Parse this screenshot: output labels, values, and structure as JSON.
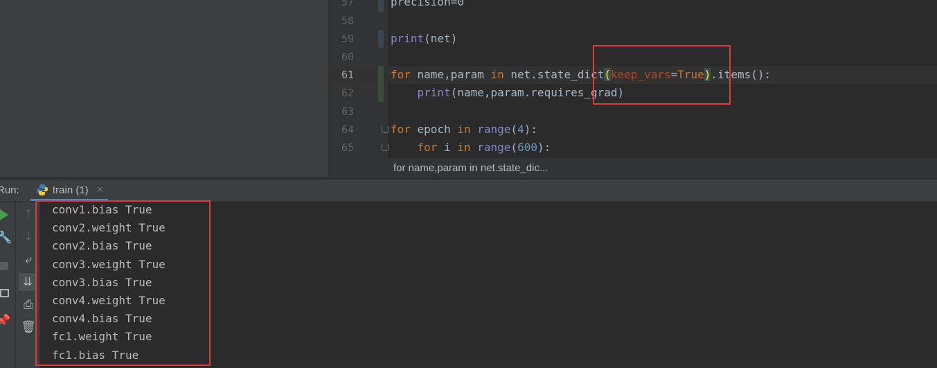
{
  "editor": {
    "lines": [
      {
        "num": "57",
        "tokens": [
          {
            "t": "precision=0",
            "c": ""
          }
        ]
      },
      {
        "num": "58",
        "tokens": []
      },
      {
        "num": "59",
        "tokens": [
          {
            "t": "print",
            "c": "bi"
          },
          {
            "t": "(net)",
            "c": ""
          }
        ]
      },
      {
        "num": "60",
        "tokens": []
      },
      {
        "num": "61",
        "current": true,
        "tokens": [
          {
            "t": "for",
            "c": "kw"
          },
          {
            "t": " name,param ",
            "c": ""
          },
          {
            "t": "in",
            "c": "kw"
          },
          {
            "t": " net.state_dict",
            "c": ""
          },
          {
            "t": "(",
            "c": "bracket-hl"
          },
          {
            "t": "keep_vars",
            "c": "param"
          },
          {
            "t": "=",
            "c": ""
          },
          {
            "t": "True",
            "c": "kw"
          },
          {
            "t": ")",
            "c": "bracket-hl"
          },
          {
            "t": ".items():",
            "c": ""
          }
        ]
      },
      {
        "num": "62",
        "tokens": [
          {
            "t": "    ",
            "c": ""
          },
          {
            "t": "print",
            "c": "bi"
          },
          {
            "t": "(name,param.requires_grad)",
            "c": ""
          }
        ]
      },
      {
        "num": "63",
        "tokens": []
      },
      {
        "num": "64",
        "tokens": [
          {
            "t": "for",
            "c": "kw"
          },
          {
            "t": " epoch ",
            "c": ""
          },
          {
            "t": "in",
            "c": "kw"
          },
          {
            "t": " ",
            "c": ""
          },
          {
            "t": "range",
            "c": "bi"
          },
          {
            "t": "(",
            "c": ""
          },
          {
            "t": "4",
            "c": "num"
          },
          {
            "t": "):",
            "c": ""
          }
        ]
      },
      {
        "num": "65",
        "tokens": [
          {
            "t": "    ",
            "c": ""
          },
          {
            "t": "for",
            "c": "kw"
          },
          {
            "t": " i ",
            "c": ""
          },
          {
            "t": "in",
            "c": "kw"
          },
          {
            "t": " ",
            "c": ""
          },
          {
            "t": "range",
            "c": "bi"
          },
          {
            "t": "(",
            "c": ""
          },
          {
            "t": "600",
            "c": "num"
          },
          {
            "t": "):",
            "c": ""
          }
        ]
      }
    ],
    "breadcrumb": "for name,param in net.state_dic..."
  },
  "run": {
    "label": "Run:",
    "tab_label": "train (1)",
    "tab_close": "×",
    "output": [
      "conv1.bias True",
      "conv2.weight True",
      "conv2.bias True",
      "conv3.weight True",
      "conv3.bias True",
      "conv4.weight True",
      "conv4.bias True",
      "fc1.weight True",
      "fc1.bias True"
    ],
    "toolbar_left": [
      "run-icon",
      "wrench-icon",
      "stop-icon",
      "layout-icon",
      "pin-icon"
    ],
    "toolbar_right": [
      "up-arrow-icon",
      "down-arrow-icon",
      "soft-wrap-icon",
      "scroll-to-end-icon",
      "print-icon",
      "trash-icon"
    ]
  },
  "colors": {
    "keyword": "#cc7832",
    "builtin": "#8888c6",
    "number": "#6897bb",
    "param": "#aa4926",
    "highlight_box": "#e13a3a",
    "run_green": "#499c54"
  }
}
